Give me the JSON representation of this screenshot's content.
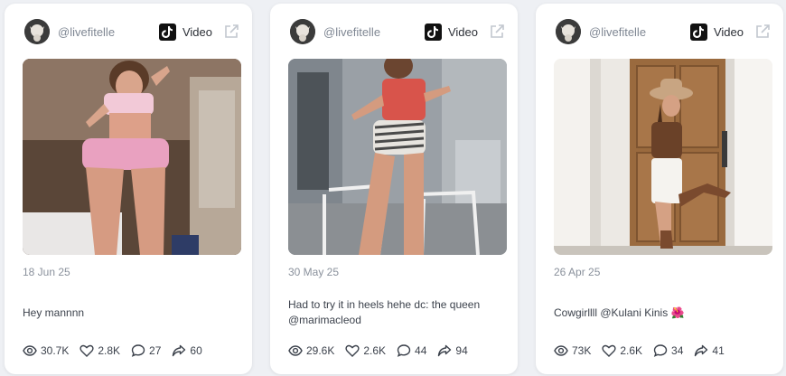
{
  "cards": [
    {
      "username": "@livefitelle",
      "platform_label": "Video",
      "platform_icon": "tiktok-logo-icon",
      "date": "18 Jun 25",
      "caption": "Hey mannnn",
      "stats": {
        "views": "30.7K",
        "likes": "2.8K",
        "comments": "27",
        "shares": "60"
      }
    },
    {
      "username": "@livefitelle",
      "platform_label": "Video",
      "platform_icon": "tiktok-logo-icon",
      "date": "30 May 25",
      "caption": "Had to try it in heels hehe dc: the queen @marimacleod",
      "stats": {
        "views": "29.6K",
        "likes": "2.6K",
        "comments": "44",
        "shares": "94"
      }
    },
    {
      "username": "@livefitelle",
      "platform_label": "Video",
      "platform_icon": "tiktok-logo-icon",
      "date": "26 Apr 25",
      "caption": "Cowgirllll @Kulani Kinis 🌺",
      "stats": {
        "views": "73K",
        "likes": "2.6K",
        "comments": "34",
        "shares": "41"
      }
    }
  ],
  "colors": {
    "page_bg": "#eef0f4",
    "card_bg": "#ffffff",
    "muted_text": "#8a919c",
    "body_text": "#3c424c"
  }
}
